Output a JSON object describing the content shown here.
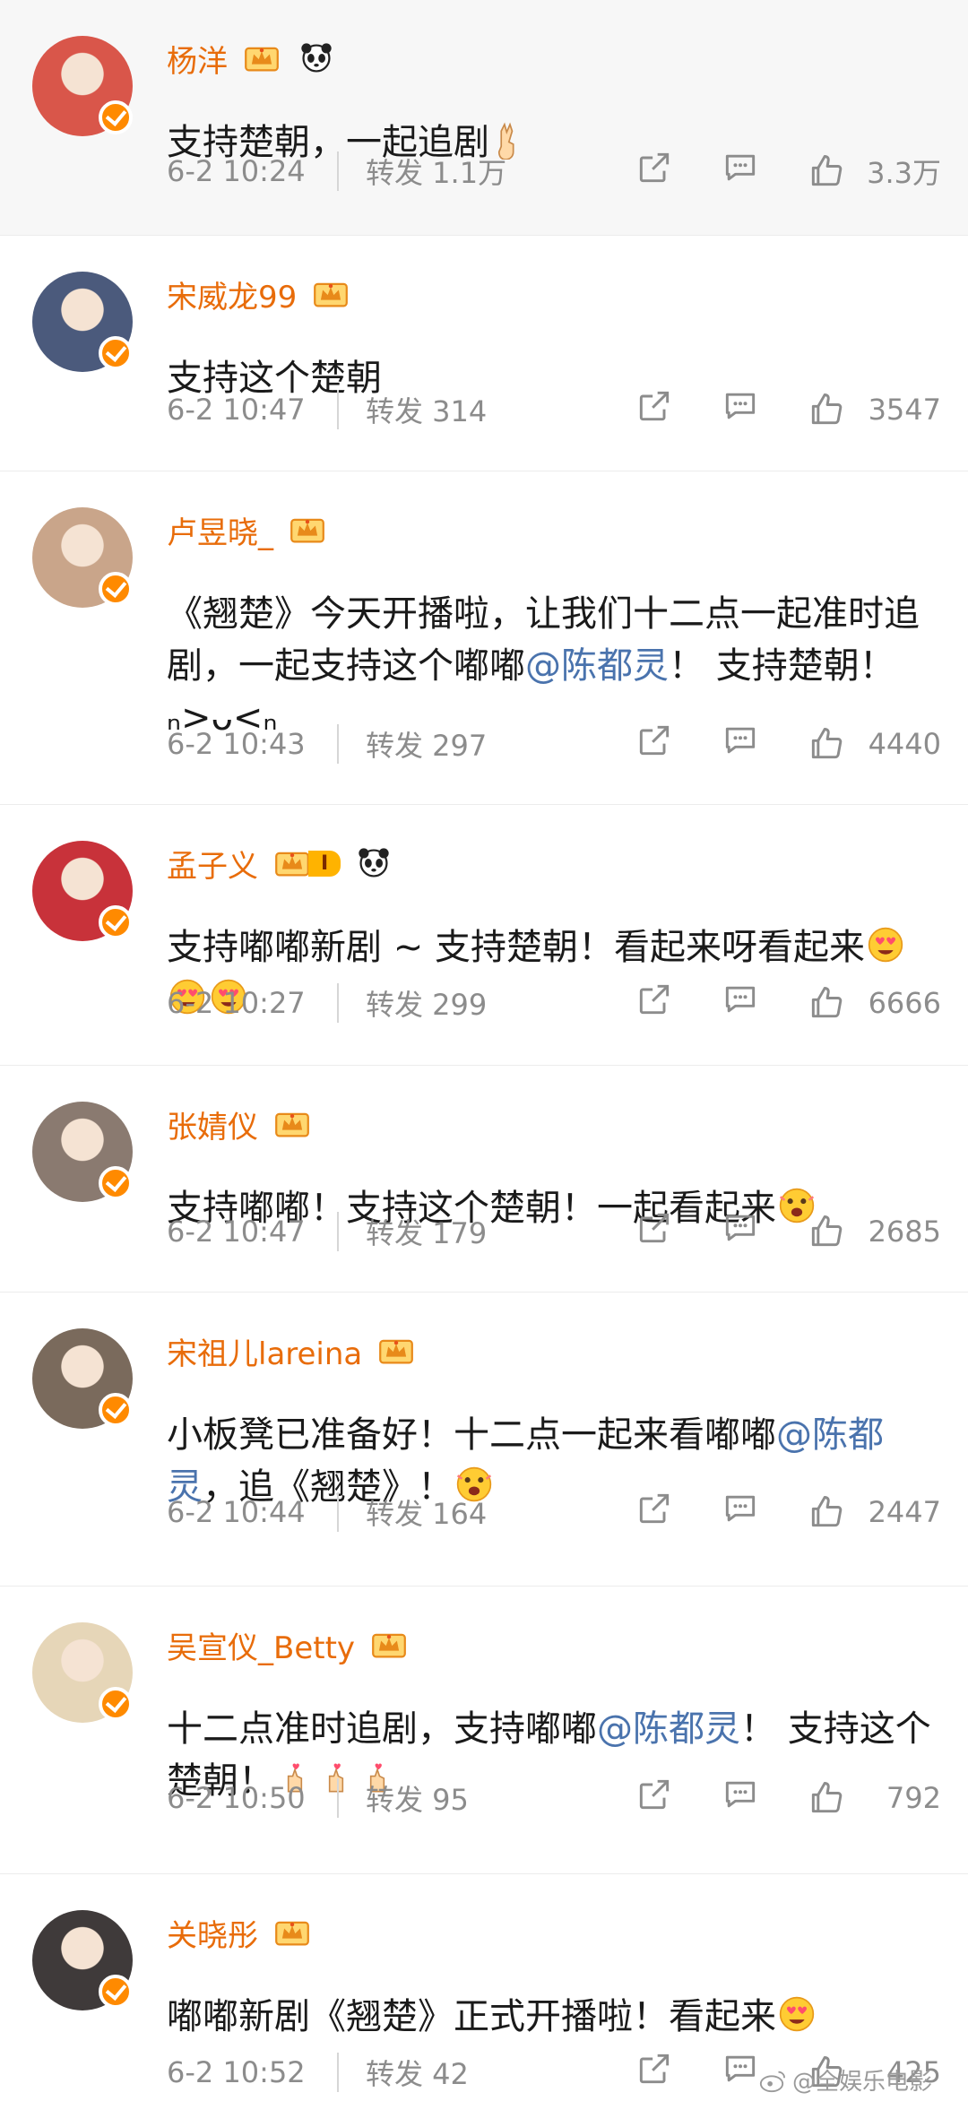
{
  "posts": [
    {
      "name": "杨洋",
      "text": [
        {
          "t": "支持楚朝，一起追剧"
        }
      ],
      "emoji_count": 1,
      "emoji": "victory-hand-emoji",
      "time": "6-2 10:24",
      "reposts": "转发 1.1万",
      "likes": "3.3万",
      "badges": [
        "crown",
        "panda"
      ],
      "avatar_color": "#d9564a"
    },
    {
      "name": "宋威龙99",
      "text": [
        {
          "t": "支持这个楚朝"
        }
      ],
      "emoji_count": 0,
      "time": "6-2 10:47",
      "reposts": "转发 314",
      "likes": "3547",
      "badges": [
        "crown"
      ],
      "avatar_color": "#4b5a7c"
    },
    {
      "name": "卢昱晓_",
      "text": [
        {
          "t": "《翘楚》今天开播啦，让我们十二点一起准时追剧，一起支持这个嘟嘟"
        },
        {
          "m": "@陈都灵"
        },
        {
          "t": "！ 支持楚朝！ ₙ>ᴗ<ₙ"
        }
      ],
      "emoji_count": 0,
      "time": "6-2 10:43",
      "reposts": "转发 297",
      "likes": "4440",
      "badges": [
        "crown"
      ],
      "avatar_color": "#c9a58a"
    },
    {
      "name": "孟子义",
      "text": [
        {
          "t": "支持嘟嘟新剧 ~ 支持楚朝！看起来呀看起来"
        }
      ],
      "emoji_count": 3,
      "emoji": "heart-eyes-emoji",
      "time": "6-2 10:27",
      "reposts": "转发 299",
      "likes": "6666",
      "badges": [
        "crown-level",
        "panda"
      ],
      "level": "I",
      "avatar_color": "#c8323a"
    },
    {
      "name": "张婧仪",
      "text": [
        {
          "t": "支持嘟嘟！支持这个楚朝！一起看起来"
        }
      ],
      "emoji_count": 1,
      "emoji": "excited-emoji",
      "time": "6-2 10:47",
      "reposts": "转发 179",
      "likes": "2685",
      "badges": [
        "crown"
      ],
      "avatar_color": "#8a7a70"
    },
    {
      "name": "宋祖儿lareina",
      "text": [
        {
          "t": "小板凳已准备好！十二点一起来看嘟嘟"
        },
        {
          "m": "@陈都灵"
        },
        {
          "t": "，追《翘楚》！"
        }
      ],
      "emoji_count": 1,
      "emoji": "excited-emoji",
      "time": "6-2 10:44",
      "reposts": "转发 164",
      "likes": "2447",
      "badges": [
        "crown"
      ],
      "avatar_color": "#7a6a5c"
    },
    {
      "name": "吴宣仪_Betty",
      "text": [
        {
          "t": "十二点准时追剧，支持嘟嘟"
        },
        {
          "m": "@陈都灵"
        },
        {
          "t": "！ 支持这个楚朝！"
        }
      ],
      "emoji_count": 3,
      "emoji": "finger-heart-emoji",
      "time": "6-2 10:50",
      "reposts": "转发 95",
      "likes": "792",
      "badges": [
        "crown"
      ],
      "avatar_color": "#e6d6b8"
    },
    {
      "name": "关晓彤",
      "text": [
        {
          "t": "嘟嘟新剧《翘楚》正式开播啦！看起来"
        }
      ],
      "emoji_count": 1,
      "emoji": "heart-eyes-emoji",
      "time": "6-2 10:52",
      "reposts": "转发 42",
      "likes": "425",
      "badges": [
        "crown"
      ],
      "avatar_color": "#3f3a3a"
    }
  ],
  "watermark": "@全娱乐电影",
  "colors": {
    "name": "#e86c0a",
    "mention": "#4a73ad",
    "verified": "#ff8a00",
    "meta": "#8c8c8c"
  }
}
